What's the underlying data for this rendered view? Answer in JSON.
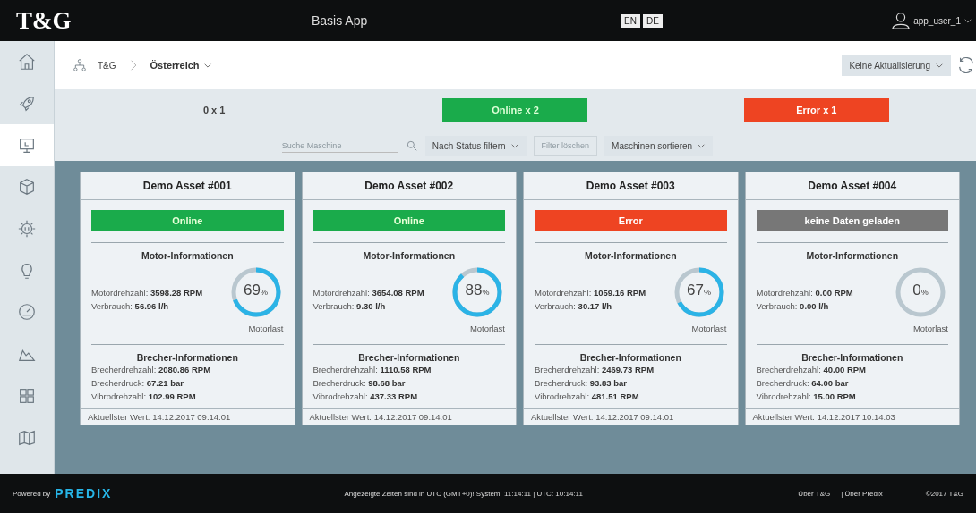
{
  "header": {
    "logo": "T&G",
    "app_title": "Basis App",
    "languages": [
      "EN",
      "DE"
    ],
    "user": "app_user_1"
  },
  "sidebar": {
    "items": [
      {
        "selected": false
      },
      {
        "selected": false
      },
      {
        "selected": true
      },
      {
        "selected": false
      },
      {
        "selected": false
      },
      {
        "selected": false
      },
      {
        "selected": false
      },
      {
        "selected": false
      },
      {
        "selected": false
      },
      {
        "selected": false
      }
    ]
  },
  "breadcrumb": {
    "root": "T&G",
    "current": "Österreich"
  },
  "refresh": {
    "label": "Keine Aktualisierung"
  },
  "summary": [
    {
      "label": "0 x 1",
      "kind": "none"
    },
    {
      "label": "Online x 2",
      "kind": "online"
    },
    {
      "label": "Error x 1",
      "kind": "error"
    }
  ],
  "filters": {
    "search_placeholder": "Suche Maschine",
    "status_filter": "Nach Status filtern",
    "clear": "Filter löschen",
    "clear_disabled": true,
    "sort": "Maschinen sortieren"
  },
  "assets": [
    {
      "title": "Demo Asset #001",
      "status": "Online",
      "kind": "online",
      "motor_heading": "Motor-Informationen",
      "motor": [
        "Motordrehzahl: **3598.28 RPM**",
        "Verbrauch: **56.96 l/h**"
      ],
      "gauge": "69",
      "gauge_unit": "%",
      "gauge_label": "Motorlast",
      "crusher_heading": "Brecher-Informationen",
      "crusher": [
        "Brecherdrehzahl: **2080.86 RPM**",
        "Brecherdruck: **67.21 bar**",
        "Vibrodrehzahl: **102.99 RPM**"
      ],
      "footer": "Aktuellster Wert: 14.12.2017 09:14:01"
    },
    {
      "title": "Demo Asset #002",
      "status": "Online",
      "kind": "online",
      "motor_heading": "Motor-Informationen",
      "motor": [
        "Motordrehzahl: **3654.08 RPM**",
        "Verbrauch: **9.30 l/h**"
      ],
      "gauge": "88",
      "gauge_unit": "%",
      "gauge_label": "Motorlast",
      "crusher_heading": "Brecher-Informationen",
      "crusher": [
        "Brecherdrehzahl: **1110.58 RPM**",
        "Brecherdruck: **98.68 bar**",
        "Vibrodrehzahl: **437.33 RPM**"
      ],
      "footer": "Aktuellster Wert: 14.12.2017 09:14:01"
    },
    {
      "title": "Demo Asset #003",
      "status": "Error",
      "kind": "error",
      "motor_heading": "Motor-Informationen",
      "motor": [
        "Motordrehzahl: **1059.16 RPM**",
        "Verbrauch: **30.17 l/h**"
      ],
      "gauge": "67",
      "gauge_unit": "%",
      "gauge_label": "Motorlast",
      "crusher_heading": "Brecher-Informationen",
      "crusher": [
        "Brecherdrehzahl: **2469.73 RPM**",
        "Brecherdruck: **93.83 bar**",
        "Vibrodrehzahl: **481.51 RPM**"
      ],
      "footer": "Aktuellster Wert: 14.12.2017 09:14:01"
    },
    {
      "title": "Demo Asset #004",
      "status": "keine Daten geladen",
      "kind": "none",
      "motor_heading": "Motor-Informationen",
      "motor": [
        "Motordrehzahl: **0.00 RPM**",
        "Verbrauch: **0.00 l/h**"
      ],
      "gauge": "0",
      "gauge_unit": "%",
      "gauge_label": "Motorlast",
      "crusher_heading": "Brecher-Informationen",
      "crusher": [
        "Brecherdrehzahl: **40.00 RPM**",
        "Brecherdruck: **64.00 bar**",
        "Vibrodrehzahl: **15.00 RPM**"
      ],
      "footer": "Aktuellster Wert: 14.12.2017 10:14:03"
    }
  ],
  "footer": {
    "powered_by": "Powered by",
    "brand": "PREDIX",
    "note": "Angezeigte Zeiten sind in UTC (GMT+0)! System: 11:14:11 | UTC: 10:14:11",
    "links": [
      "Über T&G",
      "| Über Predix"
    ],
    "copyright": "©2017 T&G"
  }
}
